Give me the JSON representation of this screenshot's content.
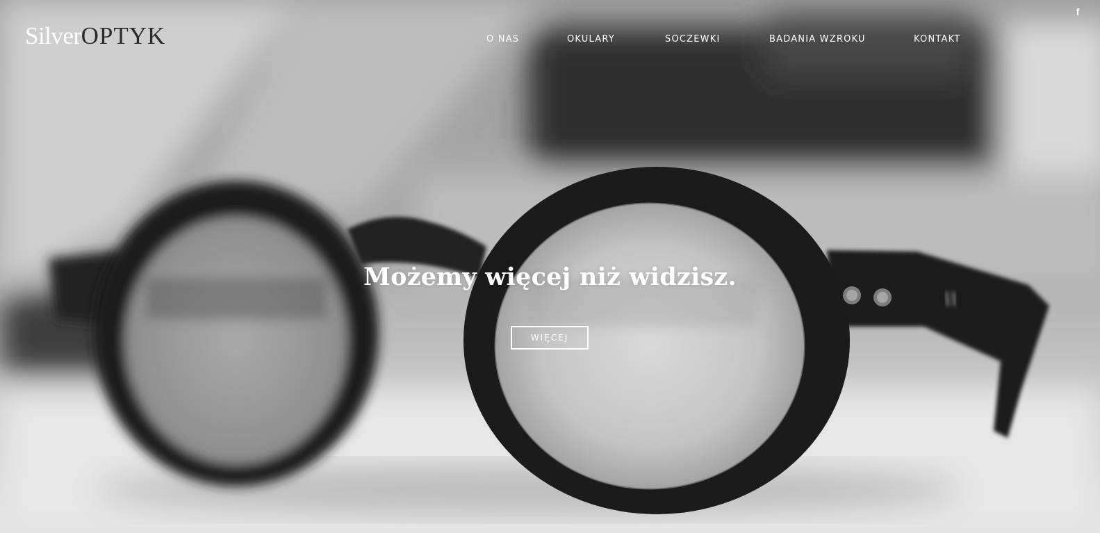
{
  "brand": {
    "part1": "Silver",
    "part2": "OPTYK"
  },
  "nav": {
    "items": [
      {
        "label": "O NAS"
      },
      {
        "label": "OKULARY"
      },
      {
        "label": "SOCZEWKI"
      },
      {
        "label": "BADANIA WZROKU"
      },
      {
        "label": "KONTAKT"
      }
    ]
  },
  "social": {
    "facebook_icon": "facebook-icon",
    "facebook_glyph": "f"
  },
  "hero": {
    "headline": "Możemy więcej niż widzisz.",
    "button_label": "WIĘCEJ",
    "image": "black-round-glasses-photo",
    "accent": "#ffffff",
    "logo_dark": "#2b2b2b"
  }
}
